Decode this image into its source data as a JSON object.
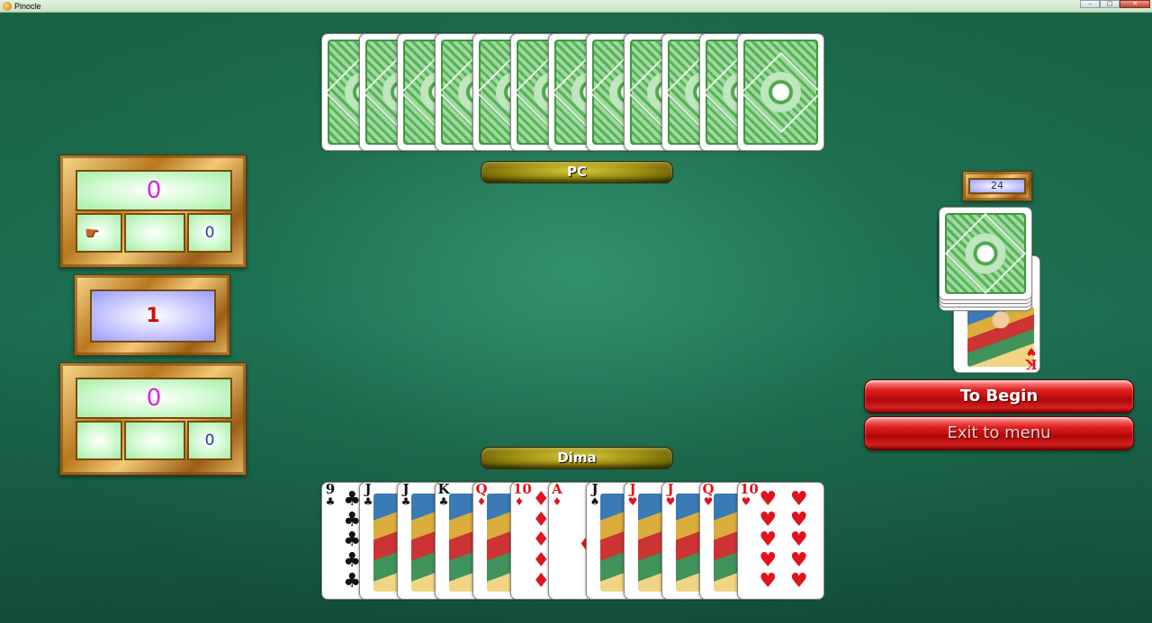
{
  "window": {
    "title": "Pinocle"
  },
  "opponent": {
    "name": "PC",
    "cards_face_down": 12
  },
  "player": {
    "name": "Dima",
    "hand": [
      {
        "rank": "9",
        "suit": "♣",
        "color": "black",
        "kind": "pips"
      },
      {
        "rank": "J",
        "suit": "♣",
        "color": "black",
        "kind": "face"
      },
      {
        "rank": "J",
        "suit": "♣",
        "color": "black",
        "kind": "face"
      },
      {
        "rank": "K",
        "suit": "♣",
        "color": "black",
        "kind": "face"
      },
      {
        "rank": "Q",
        "suit": "♦",
        "color": "red",
        "kind": "face"
      },
      {
        "rank": "10",
        "suit": "♦",
        "color": "red",
        "kind": "pips"
      },
      {
        "rank": "A",
        "suit": "♦",
        "color": "red",
        "kind": "ace"
      },
      {
        "rank": "J",
        "suit": "♠",
        "color": "black",
        "kind": "face"
      },
      {
        "rank": "J",
        "suit": "♥",
        "color": "red",
        "kind": "face"
      },
      {
        "rank": "J",
        "suit": "♥",
        "color": "red",
        "kind": "face"
      },
      {
        "rank": "Q",
        "suit": "♥",
        "color": "red",
        "kind": "face"
      },
      {
        "rank": "10",
        "suit": "♥",
        "color": "red",
        "kind": "pips"
      }
    ]
  },
  "scoreboard": {
    "top": {
      "total": "0",
      "cell_left": "",
      "cell_middle": "",
      "cell_right": "0",
      "turn_indicator_icon": "pointing-hand-icon"
    },
    "bid": "1",
    "bottom": {
      "total": "0",
      "cell_left": "",
      "cell_middle": "",
      "cell_right": "0"
    }
  },
  "deck": {
    "remaining": "24",
    "trump_card": {
      "rank": "K",
      "suit": "♥",
      "color": "red"
    }
  },
  "buttons": {
    "begin_label": "To Begin",
    "exit_label": "Exit to menu"
  },
  "colors": {
    "felt": "#1a6d4f",
    "button_red": "#d41c1c",
    "frame_gold": "#c8902c",
    "card_back_green": "#5cb85c"
  }
}
